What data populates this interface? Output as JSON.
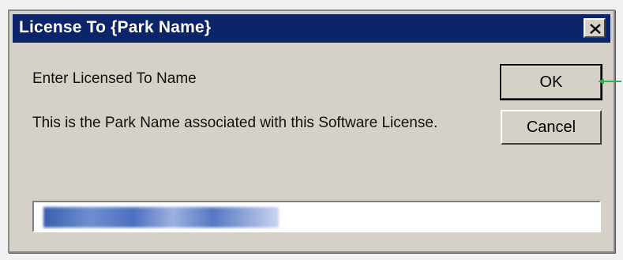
{
  "window": {
    "title": "License To {Park Name}"
  },
  "content": {
    "prompt": "Enter Licensed To Name",
    "description": "This is the Park Name associated with this Software License."
  },
  "buttons": {
    "ok_label": "OK",
    "cancel_label": "Cancel"
  },
  "input": {
    "value": ""
  },
  "colors": {
    "titlebar": "#0b246a",
    "dialog_bg": "#d5d0c8",
    "pointer": "#2fb34a"
  },
  "icons": {
    "close": "close-icon",
    "pointer": "arrow-pointer-icon"
  }
}
